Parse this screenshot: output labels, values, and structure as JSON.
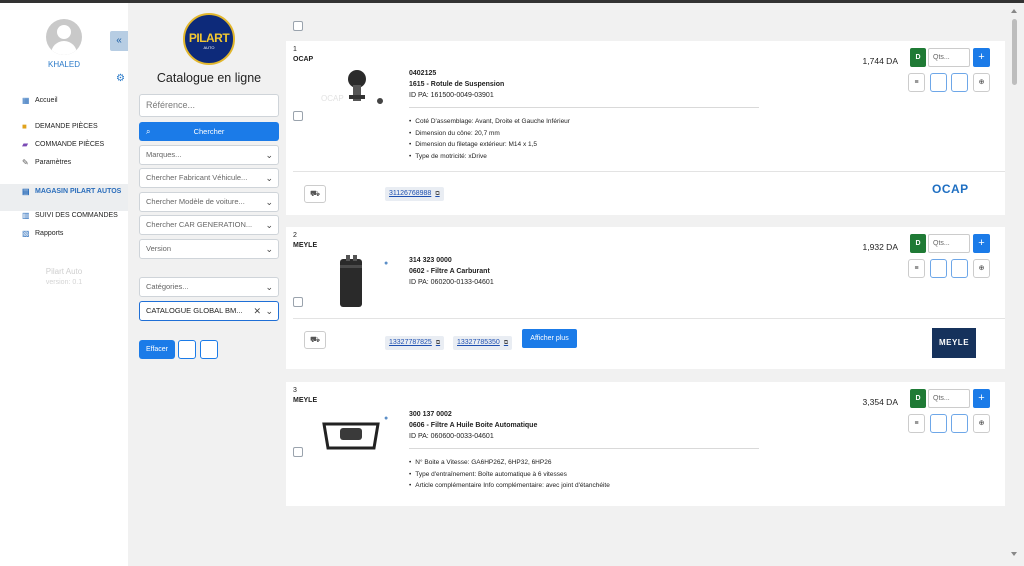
{
  "user": {
    "name": "KHALED"
  },
  "sidebar": {
    "collapse_icon": "«",
    "items": [
      {
        "label": "Accueil",
        "icon": "dashboard-icon"
      },
      {
        "label": "DEMANDE PIÈCES",
        "icon": "folder-icon"
      },
      {
        "label": "COMMANDE PIÈCES",
        "icon": "truck-icon"
      },
      {
        "label": "Paramètres",
        "icon": "wrench-icon"
      },
      {
        "label": "MAGASIN PILART AUTOS",
        "icon": "store-icon"
      },
      {
        "label": "SUIVI DES COMMANDES",
        "icon": "list-icon"
      },
      {
        "label": "Rapports",
        "icon": "report-icon"
      }
    ],
    "brand": "Pilart Auto",
    "version": "version: 0.1"
  },
  "logo": {
    "text": "PILART",
    "sub": "AUTO"
  },
  "filters": {
    "title": "Catalogue en ligne",
    "reference_placeholder": "Référence...",
    "search_button": "Chercher",
    "marques": "Marques...",
    "fabricant": "Chercher Fabricant Véhicule...",
    "modele": "Chercher Modèle de voiture...",
    "car_generation": "Chercher CAR GENERATION...",
    "version": "Version",
    "categories": "Catégories...",
    "catalogue": "CATALOGUE GLOBAL BM...",
    "clear_button": "Effacer"
  },
  "products": [
    {
      "index": "1",
      "brand": "OCAP",
      "reference": "0402125",
      "name": "1615 - Rotule de Suspension",
      "id_pa": "ID PA: 161500-0049-03901",
      "specs": [
        "Coté D'assemblage: Avant, Droite et Gauche Inférieur",
        "Dimension du cône: 20,7 mm",
        "Dimension du filetage extérieur: M14 x 1,5",
        "Type de motricité: xDrive"
      ],
      "price": "1,744 DA",
      "oem_refs": [
        "31126768988"
      ],
      "brand_logo": "OCAP"
    },
    {
      "index": "2",
      "brand": "MEYLE",
      "reference": "314 323 0000",
      "name": "0602 - Filtre A Carburant",
      "id_pa": "ID PA: 060200-0133-04601",
      "specs": [],
      "price": "1,932 DA",
      "oem_refs": [
        "13327787825",
        "13327785350"
      ],
      "more_button": "Afficher plus",
      "brand_logo": "MEYLE"
    },
    {
      "index": "3",
      "brand": "MEYLE",
      "reference": "300 137 0002",
      "name": "0606 - Filtre A Huile Boite Automatique",
      "id_pa": "ID PA: 060600-0033-04601",
      "specs": [
        "N° Boite a Vitesse: GA6HP26Z, 6HP32, 6HP26",
        "Type d'entraînement: Boîte automatique à 6 vitesses",
        "Article complémentaire Info complémentaire: avec joint d'étanchéite"
      ],
      "price": "3,354 DA"
    }
  ],
  "common": {
    "d_label": "D",
    "qty_placeholder": "Qts...",
    "plus": "+",
    "list_icon": "≡",
    "globe_icon": "⊕",
    "car_icon": "⛟",
    "copy_icon": "⧉"
  },
  "colors": {
    "accent": "#1b7be8",
    "d_button": "#1f7a35",
    "meyle_bg": "#16325c"
  }
}
